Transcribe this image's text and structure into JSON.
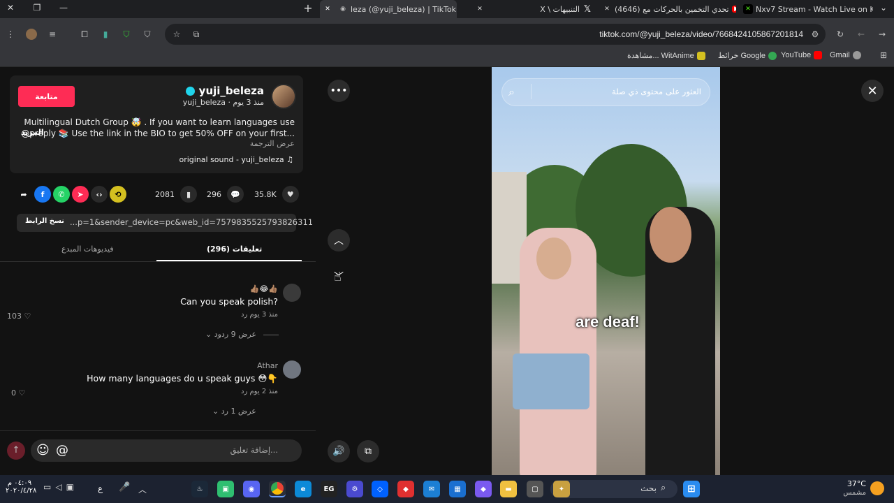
{
  "tabs": [
    {
      "label": "Nxv7 Stream - Watch Live on K",
      "icon": "kick-icon",
      "color": "#53fc18"
    },
    {
      "label": "(4646) تحدي التخمين بالحركات مع",
      "icon": "youtube-icon",
      "color": "#ff0000"
    },
    {
      "label": "X \\ التنبيهات",
      "icon": "x-icon",
      "color": "#000000"
    },
    {
      "label": "leza (@yuji_beleza) | TikTok",
      "icon": "tiktok-icon",
      "color": "#000000"
    }
  ],
  "address": {
    "url": "tiktok.com/@yuji_beleza/video/7668424105867201814"
  },
  "bookmarks": [
    {
      "label": "Gmail"
    },
    {
      "label": "YouTube"
    },
    {
      "label": "خرائط Google"
    },
    {
      "label": "مشاهدة... WitAnime"
    }
  ],
  "profile": {
    "username": "yuji_beleza",
    "handle_line": "yuji_beleza · منذ 3 يوم",
    "follow_label": "متابعة",
    "desc_line1": "Multilingual Dutch Group 🤯 . If you want to learn languages use",
    "desc_line2": "@preply 📚 Use the link in the BIO to get 50% OFF on your first...",
    "more_label": "المزيد",
    "translate_label": "عرض الترجمة",
    "sound": "original sound - yuji_beleza"
  },
  "actions": {
    "likes": "35.8K",
    "comments": "296",
    "saves": "2081"
  },
  "link": {
    "url": "...p=1&sender_device=pc&web_id=7579835525793826311",
    "copy_label": "نسخ الرابط"
  },
  "tabs_panel": {
    "comments_tab": "تعليقات (296)",
    "creator_tab": "فيديوهات المبدع"
  },
  "comments": [
    {
      "author": "👍🏽😂👍🏽",
      "text": "Can you speak polish?",
      "meta": "منذ 3 يوم   رد",
      "likes": "103",
      "replies": "عرض 9 ردود"
    },
    {
      "author": "Athar",
      "text": "How many languages do u speak guys 😳👇",
      "meta": "منذ 2 يوم   رد",
      "likes": "0",
      "replies": "عرض 1 رد"
    }
  ],
  "comment_input": {
    "placeholder": "إضافة تعليق..."
  },
  "video": {
    "search_placeholder": "العثور على محتوى ذي صلة",
    "caption": "are deaf!"
  },
  "taskbar": {
    "weather_temp": "37°C",
    "weather_desc": "مشمس",
    "search_label": "بحث",
    "time": "٠٤:٠٩ م",
    "date": "٢٠٢٠/٤/٢٨",
    "lang": "ع"
  }
}
